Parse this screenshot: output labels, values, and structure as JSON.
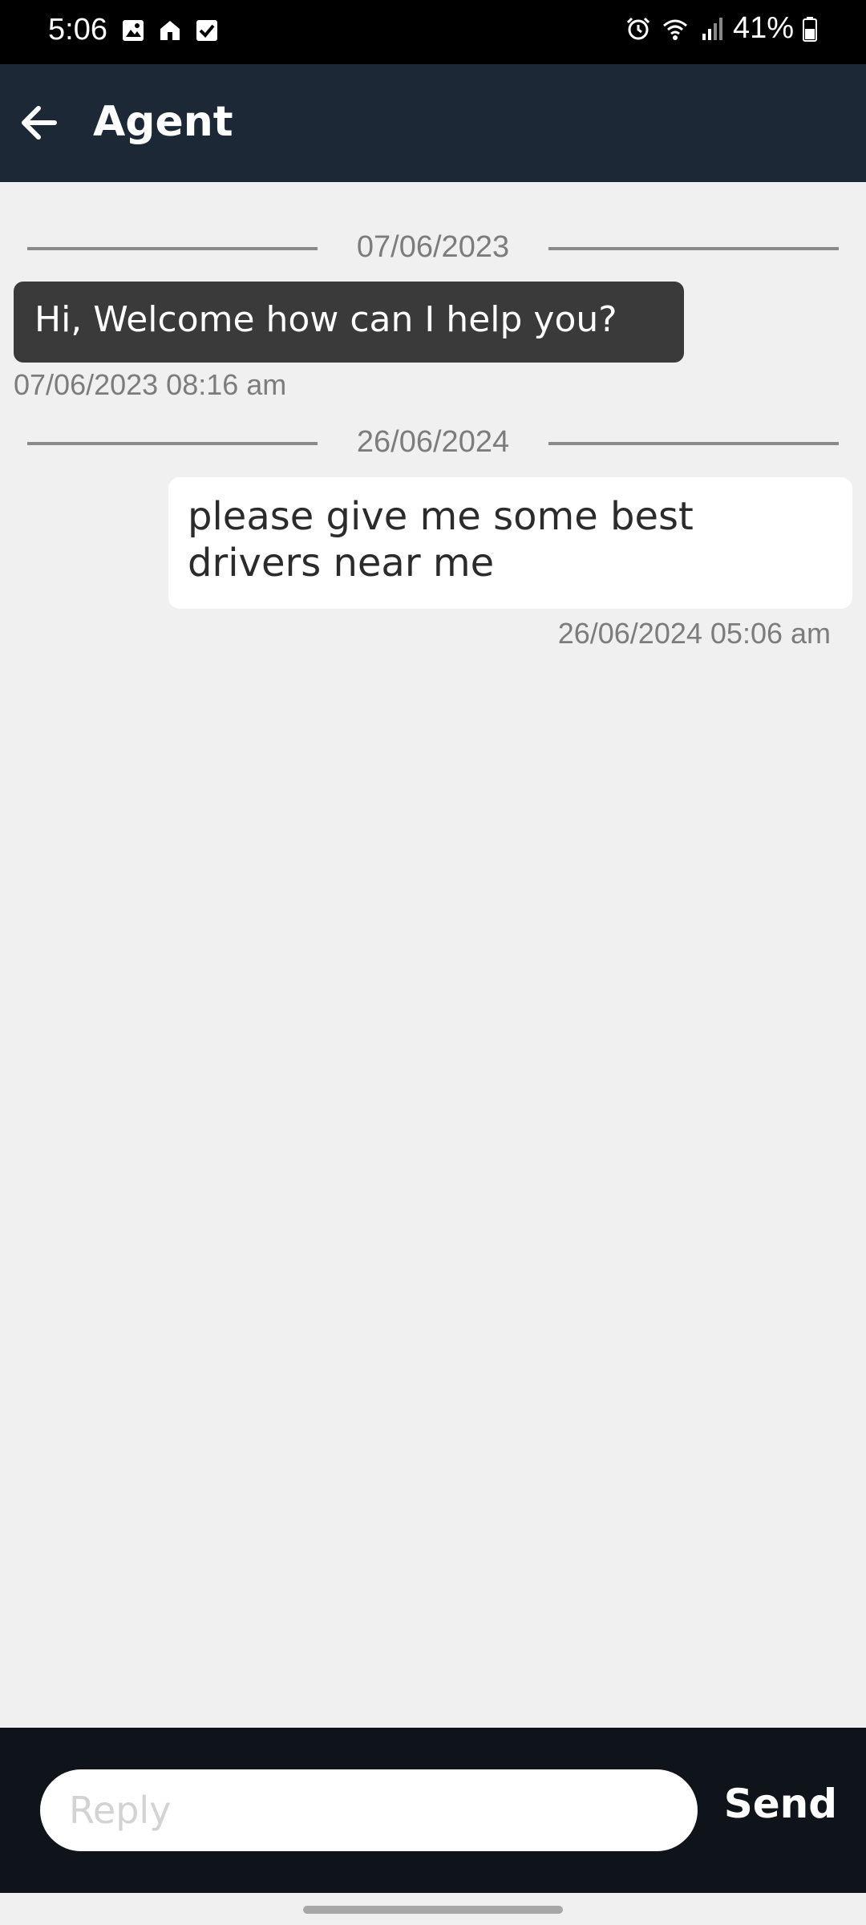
{
  "status_bar": {
    "time": "5:06",
    "battery": "41%",
    "left_icons": [
      "gallery-icon",
      "home-icon",
      "checkbox-icon"
    ],
    "right_icons": [
      "alarm-icon",
      "wifi-icon",
      "signal-icon",
      "battery-icon"
    ]
  },
  "header": {
    "title": "Agent",
    "back_icon": "arrow-left-icon"
  },
  "chat": {
    "sections": [
      {
        "date": "07/06/2023",
        "messages": [
          {
            "direction": "incoming",
            "text": "Hi, Welcome how can I help you?",
            "time": "07/06/2023 08:16 am"
          }
        ]
      },
      {
        "date": "26/06/2024",
        "messages": [
          {
            "direction": "outgoing",
            "text": "please give me some best drivers near me",
            "time": "26/06/2024 05:06 am"
          }
        ]
      }
    ]
  },
  "composer": {
    "placeholder": "Reply",
    "value": "",
    "send_label": "Send"
  },
  "colors": {
    "header_bg": "#1c2836",
    "composer_bg": "#0f141b",
    "incoming_bubble": "#3a3a3a",
    "outgoing_bubble": "#ffffff",
    "chat_bg": "#f0f0f0"
  }
}
